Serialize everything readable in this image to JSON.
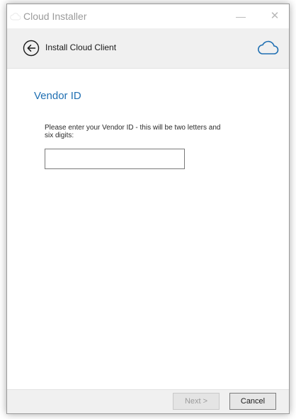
{
  "window": {
    "title": "Cloud Installer",
    "minimize_glyph": "—",
    "close_glyph": "✕"
  },
  "header": {
    "title": "Install Cloud Client",
    "back_icon": "back-arrow-circle-icon",
    "brand_icon": "cloud-outline-icon"
  },
  "main": {
    "heading": "Vendor ID",
    "instruction": "Please enter your Vendor ID - this will be two letters and six digits:",
    "vendor_id": {
      "value": "",
      "placeholder": ""
    }
  },
  "footer": {
    "next_label": "Next >",
    "next_enabled": false,
    "cancel_label": "Cancel"
  },
  "colors": {
    "accent": "#1f6fb2",
    "header_bg": "#f0f0f0",
    "title_text": "#9b9b9b"
  }
}
